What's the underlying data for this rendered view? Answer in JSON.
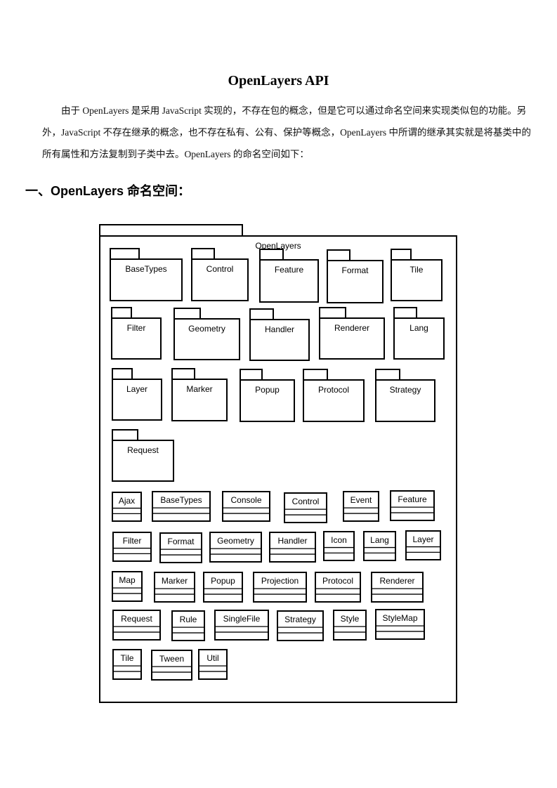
{
  "document": {
    "title": "OpenLayers API",
    "paragraph_lines": [
      "　　由于 OpenLayers 是采用 JavaScript 实现的，不存在包的概念，但是它可以通过命名空间来实现类似包的功能。另",
      "外，JavaScript 不存在继承的概念，也不存在私有、公有、保护等概念，OpenLayers 中所谓的继承其实就是将基类中的",
      "所有属性和方法复制到子类中去。OpenLayers 的命名空间如下："
    ],
    "section_heading": "一、OpenLayers 命名空间："
  },
  "diagram": {
    "root_package": "OpenLayers",
    "packages": [
      "BaseTypes",
      "Control",
      "Feature",
      "Format",
      "Tile",
      "Filter",
      "Geometry",
      "Handler",
      "Renderer",
      "Lang",
      "Layer",
      "Marker",
      "Popup",
      "Protocol",
      "Strategy",
      "Request"
    ],
    "classes": [
      "Ajax",
      "BaseTypes",
      "Console",
      "Control",
      "Event",
      "Feature",
      "Filter",
      "Format",
      "Geometry",
      "Handler",
      "Icon",
      "Lang",
      "Layer",
      "Map",
      "Marker",
      "Popup",
      "Projection",
      "Protocol",
      "Renderer",
      "Request",
      "Rule",
      "SingleFile",
      "Strategy",
      "Style",
      "StyleMap",
      "Tile",
      "Tween",
      "Util"
    ]
  }
}
